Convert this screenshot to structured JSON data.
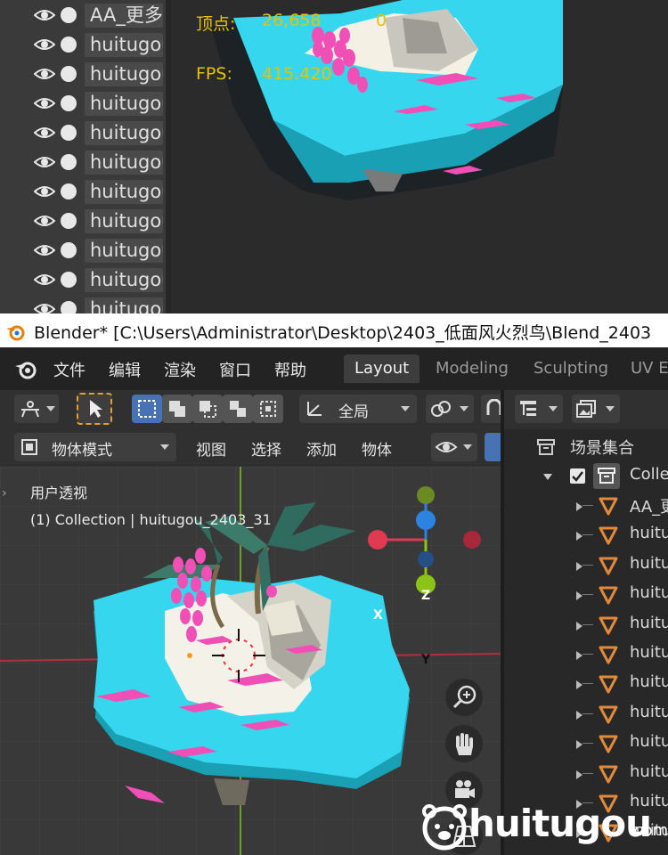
{
  "top_panel": {
    "outliner_rows": [
      {
        "label": "AA_更多"
      },
      {
        "label": "huitugou"
      },
      {
        "label": "huitugou"
      },
      {
        "label": "huitugou"
      },
      {
        "label": "huitugou"
      },
      {
        "label": "huitugou"
      },
      {
        "label": "huitugou"
      },
      {
        "label": "huitugou"
      },
      {
        "label": "huitugou"
      },
      {
        "label": "huitugou"
      },
      {
        "label": "huitugou"
      }
    ],
    "stats": {
      "vertices_label": "顶点:",
      "vertices_value": "26,658",
      "vertices_selected": "0",
      "fps_label": "FPS:",
      "fps_value": "415.420"
    }
  },
  "titlebar": {
    "text": "Blender* [C:\\Users\\Administrator\\Desktop\\2403_低面风火烈鸟\\Blend_2403"
  },
  "menu": {
    "items": [
      "文件",
      "编辑",
      "渲染",
      "窗口",
      "帮助"
    ],
    "tabs": [
      {
        "label": "Layout",
        "active": true
      },
      {
        "label": "Modeling",
        "active": false
      },
      {
        "label": "Sculpting",
        "active": false
      },
      {
        "label": "UV E",
        "active": false
      }
    ]
  },
  "viewport": {
    "transform_orientation": "全局",
    "mode": "物体模式",
    "header_menus": [
      "视图",
      "选择",
      "添加",
      "物体"
    ],
    "view_name": "用户透视",
    "collection_info": "(1) Collection | huitugou_2403_31",
    "gizmo": {
      "x": "X",
      "y": "Y",
      "z": "Z"
    },
    "colors": {
      "x_axis": "#e03a52",
      "y_axis": "#8bc417",
      "z_axis": "#2c84e0",
      "island_top": "#35d6ee",
      "island_side": "#1aa4b8",
      "flamingo": "#f04fb5"
    }
  },
  "outliner": {
    "scene_collection": "场景集合",
    "collection": "Collection",
    "objects": [
      "AA_更",
      "huitu",
      "huitu",
      "huitu",
      "huitu",
      "huitu",
      "huitu",
      "huitu",
      "huitu",
      "huitu",
      "huitu",
      "huitu"
    ]
  },
  "watermark": {
    "text": "huitugou",
    "suffix": ".com"
  }
}
